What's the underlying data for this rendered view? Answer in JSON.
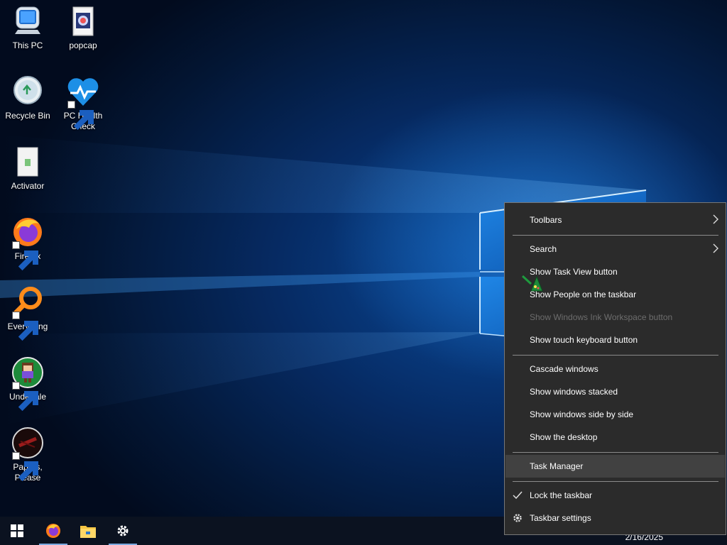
{
  "desktop": {
    "icons": [
      {
        "label": "This PC",
        "icon": "this-pc-icon"
      },
      {
        "label": "popcap",
        "icon": "folder-icon"
      },
      {
        "label": "Recycle Bin",
        "icon": "recycle-bin-icon"
      },
      {
        "label": "PC Health Check",
        "icon": "pc-health-check-icon"
      },
      {
        "label": "Activator",
        "icon": "document-icon"
      },
      {
        "label": "Firefox",
        "icon": "firefox-icon"
      },
      {
        "label": "Everything",
        "icon": "everything-search-icon"
      },
      {
        "label": "Undertale",
        "icon": "undertale-icon"
      },
      {
        "label": "Papers, Please",
        "icon": "papers-please-icon"
      }
    ]
  },
  "context_menu": {
    "items": [
      {
        "label": "Toolbars",
        "submenu": true
      },
      {
        "label": "Search",
        "submenu": true
      },
      {
        "label": "Show Task View button"
      },
      {
        "label": "Show People on the taskbar"
      },
      {
        "label": "Show Windows Ink Workspace button",
        "disabled": true
      },
      {
        "label": "Show touch keyboard button"
      },
      {
        "label": "Cascade windows"
      },
      {
        "label": "Show windows stacked"
      },
      {
        "label": "Show windows side by side"
      },
      {
        "label": "Show the desktop"
      },
      {
        "label": "Task Manager",
        "highlighted": true
      },
      {
        "label": "Lock the taskbar",
        "checked": true
      },
      {
        "label": "Taskbar settings",
        "icon": "gear-icon"
      }
    ]
  },
  "taskbar": {
    "buttons": [
      "start-icon",
      "firefox-icon",
      "file-explorer-icon",
      "settings-gear-icon"
    ],
    "clock_date": "2/16/2025"
  },
  "colors": {
    "menu_bg": "#2b2b2b",
    "menu_highlight": "#414141",
    "taskbar_bg": "#0b1220",
    "accent": "#0a4b9c"
  }
}
